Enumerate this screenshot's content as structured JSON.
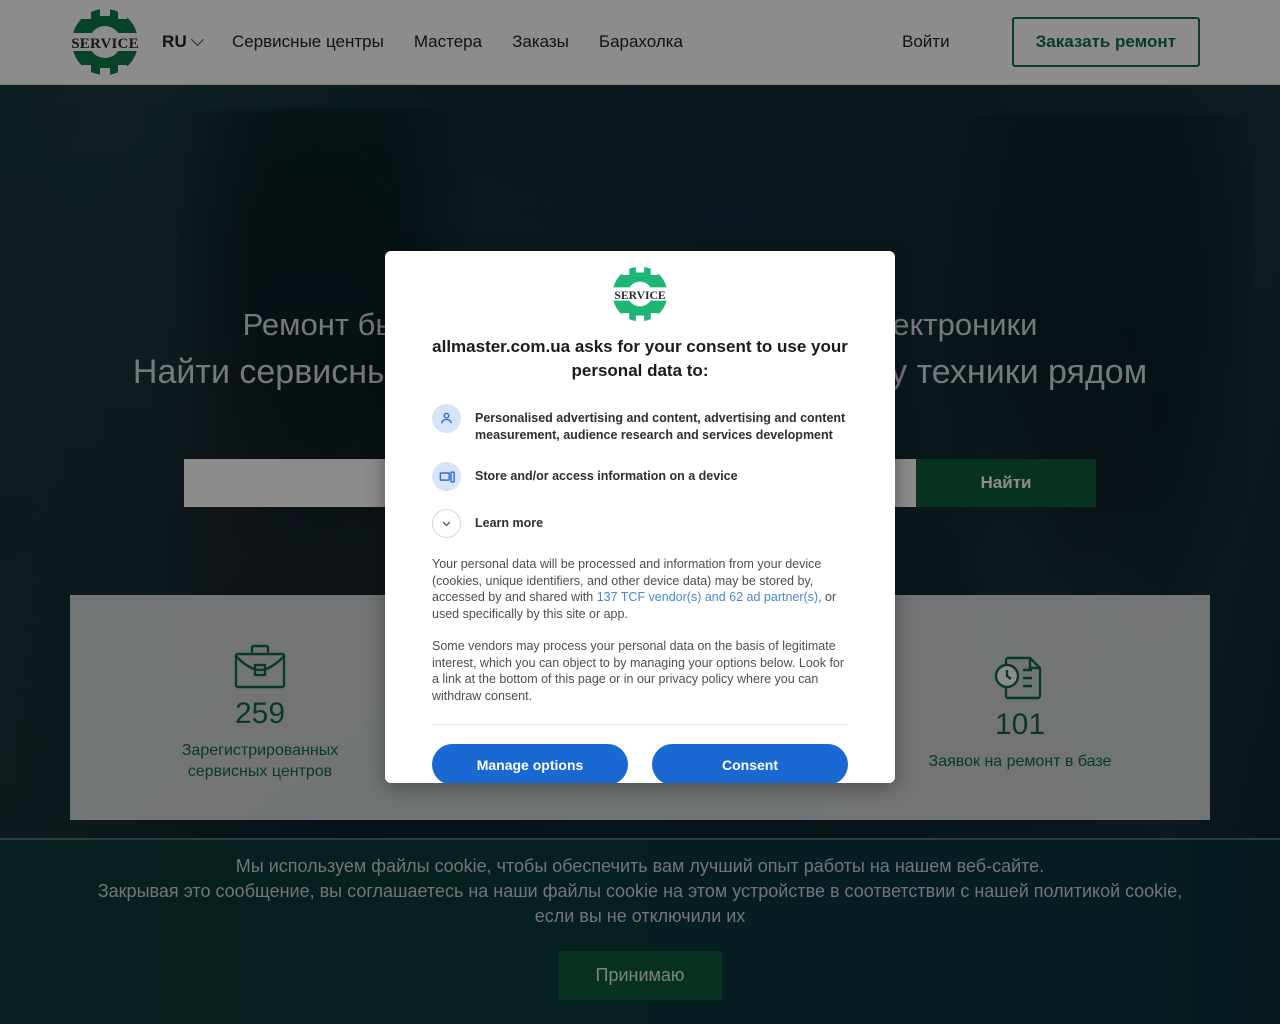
{
  "header": {
    "logo_text": "SERVICE",
    "lang": "RU",
    "nav": [
      {
        "label": "Сервисные центры"
      },
      {
        "label": "Мастера"
      },
      {
        "label": "Заказы"
      },
      {
        "label": "Барахолка"
      }
    ],
    "login_label": "Войти",
    "order_label": "Заказать ремонт"
  },
  "hero": {
    "title_line1": "Ремонт бытовой, компьютерной техники и электроники",
    "title_line2": "Найти сервисный центр или мастера по ремонту техники рядом",
    "search_placeholder": "",
    "search_value": "",
    "search_button": "Найти"
  },
  "stats": [
    {
      "icon": "briefcase-icon",
      "number": "259",
      "label": "Зарегистрированных сервисных центров"
    },
    {
      "icon": "users-icon",
      "number": "",
      "label": ""
    },
    {
      "icon": "document-clock-icon",
      "number": "101",
      "label": "Заявок на ремонт в базе"
    }
  ],
  "cookie_banner": {
    "line1": "Мы используем файлы cookie, чтобы обеспечить вам лучший опыт работы на нашем веб-сайте.",
    "line2": "Закрывая это сообщение, вы соглашаетесь на наши файлы cookie на этом устройстве в соответствии с нашей политикой cookie,",
    "line3": "если вы не отключили их",
    "accept_label": "Принимаю"
  },
  "consent_modal": {
    "logo_text": "SERVICE",
    "title": "allmaster.com.ua asks for your consent to use your personal data to:",
    "purposes": [
      {
        "icon": "person-icon",
        "text": "Personalised advertising and content, advertising and content measurement, audience research and services development"
      },
      {
        "icon": "device-icon",
        "text": "Store and/or access information on a device"
      },
      {
        "icon": "chevron-down-icon",
        "text": "Learn more"
      }
    ],
    "paragraph1_before": "Your personal data will be processed and information from your device (cookies, unique identifiers, and other device data) may be stored by, accessed by and shared with ",
    "paragraph1_link": "137 TCF vendor(s) and 62 ad partner(s)",
    "paragraph1_after": ", or used specifically by this site or app.",
    "paragraph2": "Some vendors may process your personal data on the basis of legitimate interest, which you can object to by managing your options below. Look for a link at the bottom of this page or in our privacy policy where you can withdraw consent.",
    "manage_label": "Manage options",
    "consent_label": "Consent"
  },
  "colors": {
    "brand_green": "#136b45",
    "dark_green": "#0c5c3a",
    "blue_button": "#1a68d1",
    "link_blue": "#4a86d8"
  }
}
